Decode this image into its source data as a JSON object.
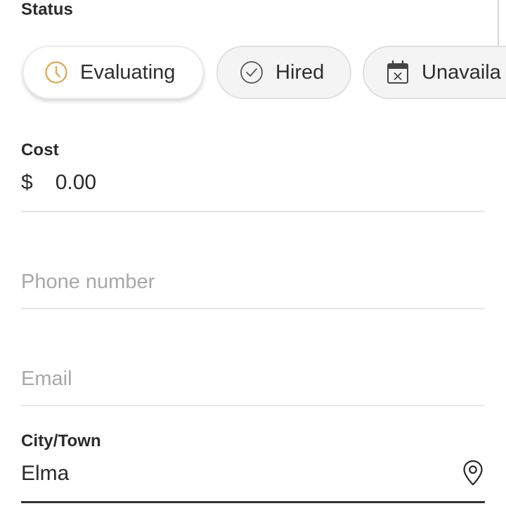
{
  "status": {
    "label": "Status",
    "chips": [
      {
        "label": "Evaluating",
        "icon": "clock-icon",
        "selected": true,
        "icon_color": "#e2a34a"
      },
      {
        "label": "Hired",
        "icon": "check-circle-icon",
        "selected": false
      },
      {
        "label": "Unavaila",
        "icon": "calendar-x-icon",
        "selected": false
      }
    ]
  },
  "cost": {
    "label": "Cost",
    "currency": "$",
    "value": "0.00"
  },
  "phone": {
    "placeholder": "Phone number"
  },
  "email": {
    "placeholder": "Email"
  },
  "city": {
    "label": "City/Town",
    "value": "Elma",
    "icon": "location-pin-icon"
  }
}
